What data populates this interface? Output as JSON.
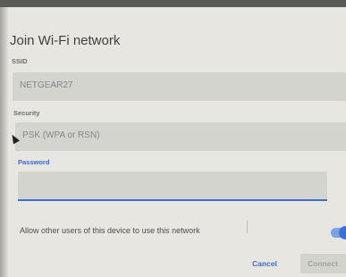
{
  "dialog": {
    "title": "Join Wi-Fi network",
    "ssid_label": "SSID",
    "ssid_value": "NETGEAR27",
    "security_label": "Security",
    "security_value": "PSK (WPA or RSN)",
    "password_label": "Password",
    "password_value": "",
    "allow_label": "Allow other users of this device to use this network",
    "allow_enabled": true,
    "cancel_label": "Cancel",
    "connect_label": "Connect"
  },
  "colors": {
    "accent": "#3b6fd8",
    "dialog_bg": "#e7e6e1",
    "field_bg": "#d4d4cf"
  },
  "icons": {
    "cursor": "mouse-pointer-icon"
  }
}
